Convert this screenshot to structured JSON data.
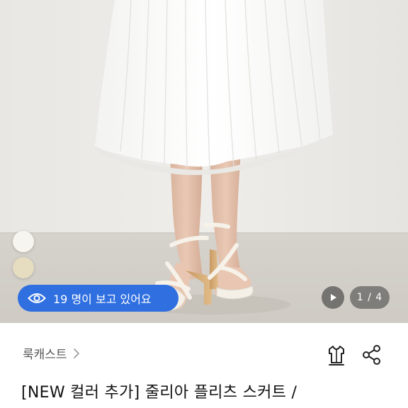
{
  "gallery": {
    "viewers_text": "19 명이 보고 있어요",
    "counter": "1 / 4",
    "swatches": [
      {
        "name": "white",
        "color": "#f7f5f0"
      },
      {
        "name": "beige",
        "color": "#e6dcc0"
      }
    ],
    "pill_color": "#2f6fe0"
  },
  "product": {
    "shop_name": "룩캐스트",
    "title": "[NEW 컬러 추가] 줄리아 플리츠 스커트 /"
  },
  "icons": {
    "eye": "eye-icon",
    "play": "play-icon",
    "closet": "closet-icon",
    "share": "share-icon",
    "chevron": "chevron-right-icon"
  }
}
